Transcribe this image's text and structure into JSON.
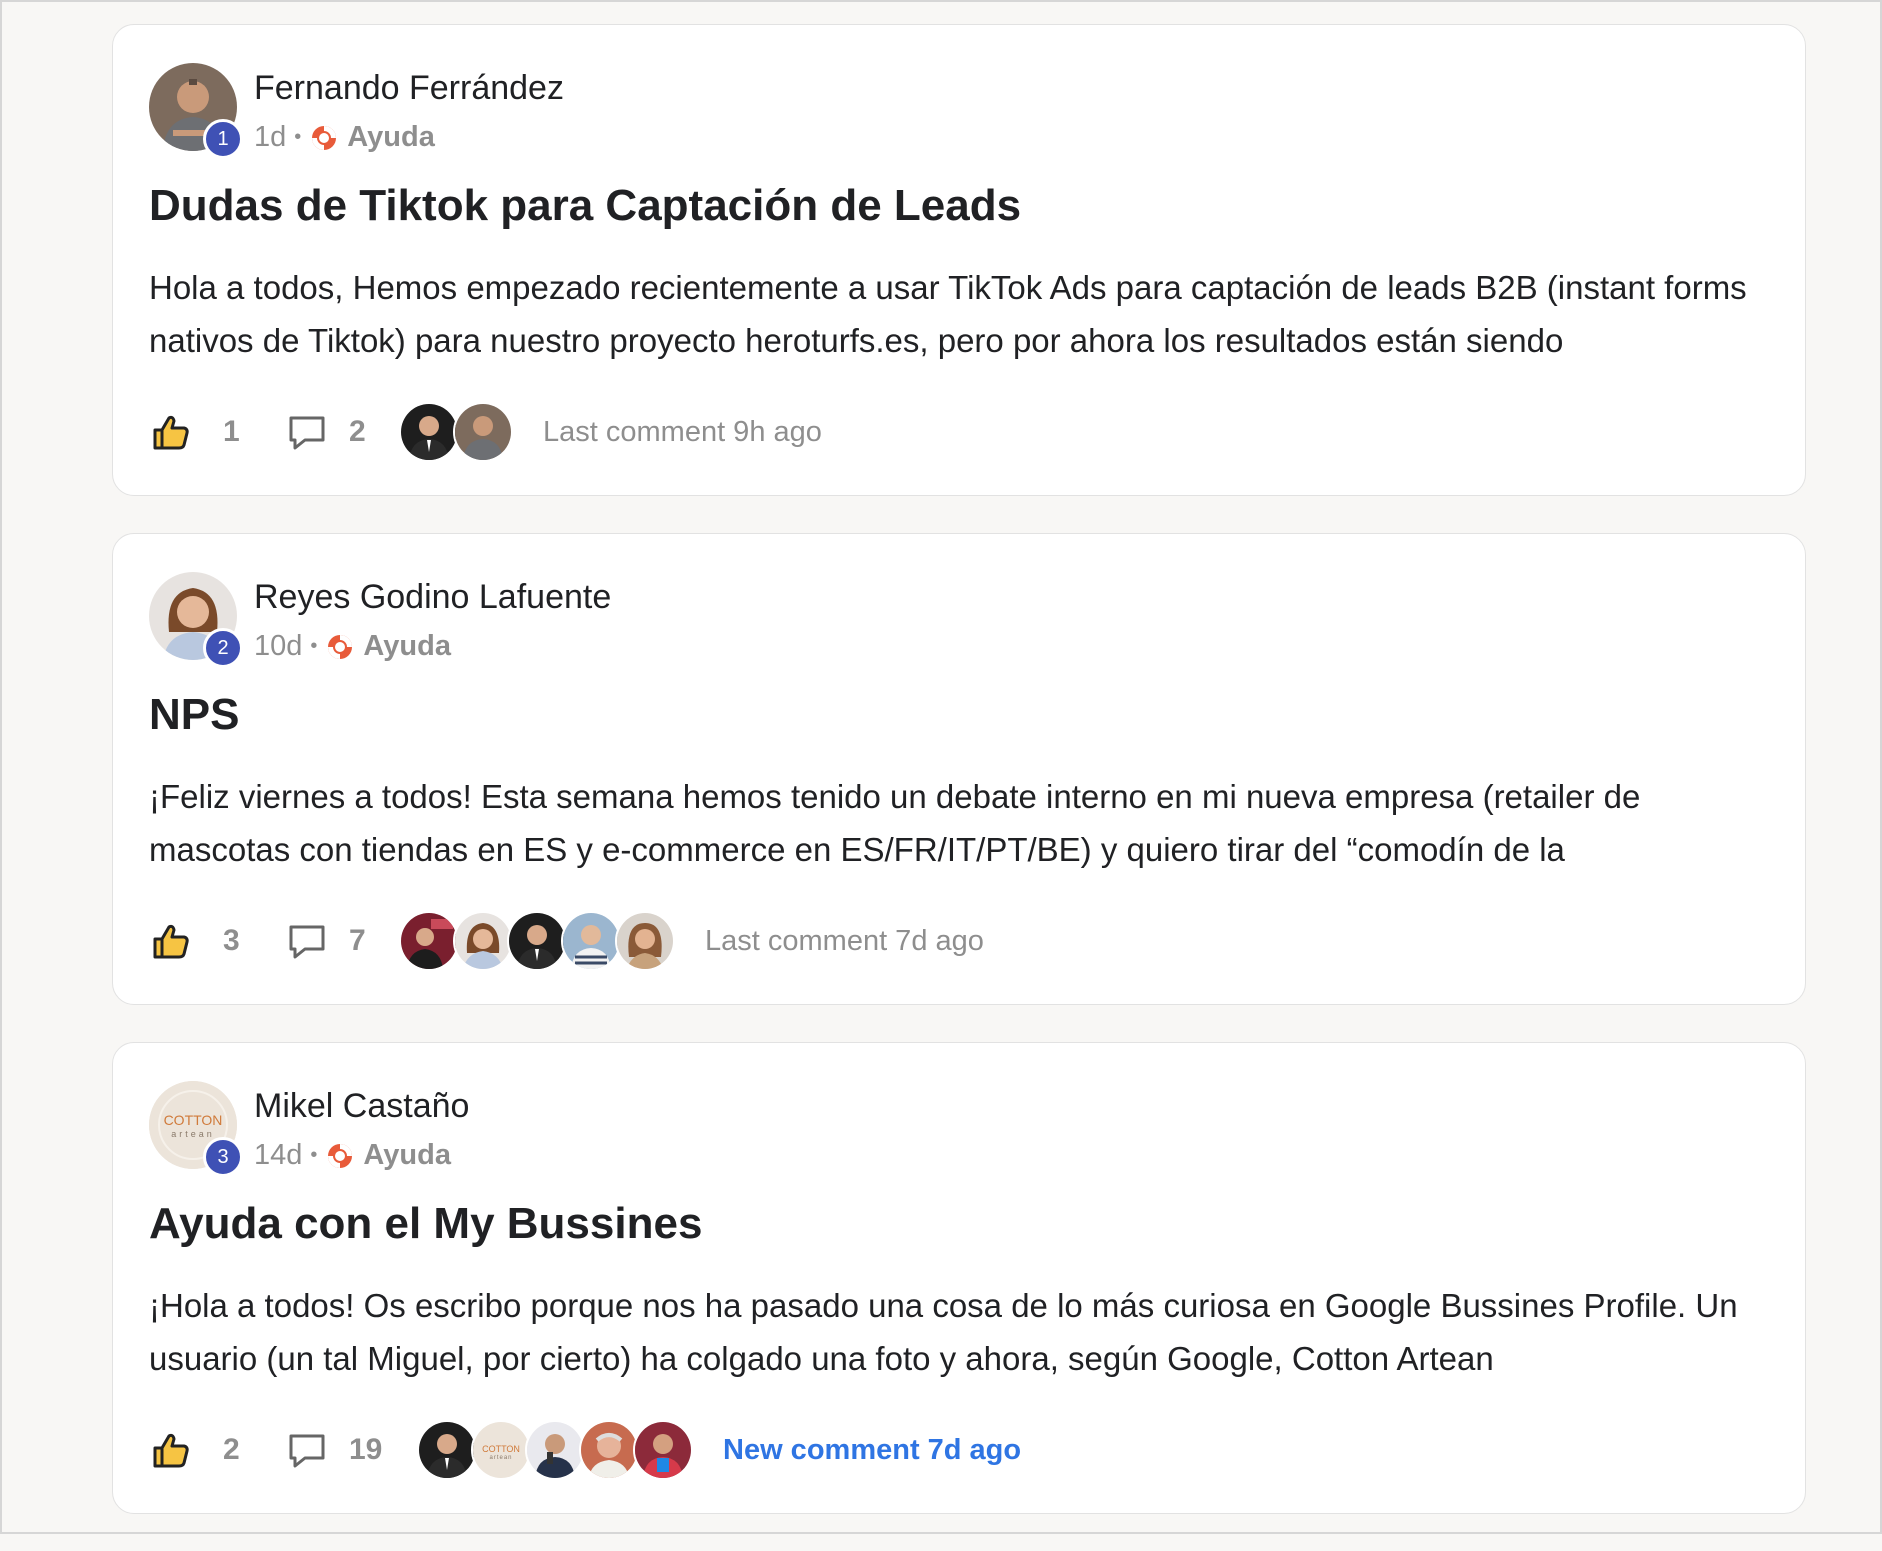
{
  "posts": [
    {
      "author": "Fernando Ferrández",
      "rank": "1",
      "time": "1d",
      "category": "Ayuda",
      "title": "Dudas de Tiktok para Captación de Leads",
      "body": "Hola a todos, Hemos empezado recientemente a usar TikTok Ads para captación de leads B2B (instant forms nativos de Tiktok) para nuestro proyecto heroturfs.es, pero por ahora los resultados están siendo",
      "likes": "1",
      "comments": "2",
      "last_comment": "Last comment 9h ago",
      "commenter_avatars": [
        "dark-suit",
        "brown-man"
      ]
    },
    {
      "author": "Reyes Godino Lafuente",
      "rank": "2",
      "time": "10d",
      "category": "Ayuda",
      "title": "NPS",
      "body": "¡Feliz viernes a todos! Esta semana hemos tenido un debate interno en mi nueva empresa (retailer de mascotas con tiendas en ES y e-commerce en ES/FR/IT/PT/BE) y quiero tirar del “comodín de la",
      "likes": "3",
      "comments": "7",
      "last_comment": "Last comment 7d ago",
      "commenter_avatars": [
        "red-stage",
        "woman-smile",
        "dark-suit",
        "striped-man",
        "woman-curly"
      ]
    },
    {
      "author": "Mikel Castaño",
      "rank": "3",
      "time": "14d",
      "category": "Ayuda",
      "title": "Ayuda con el My Bussines",
      "body": "¡Hola a todos! Os escribo porque nos ha pasado una cosa de lo más curiosa en Google Bussines Profile. Un usuario (un tal Miguel, por cierto) ha colgado una foto y ahora, según Google, Cotton Artean",
      "likes": "2",
      "comments": "19",
      "last_comment": "New comment 7d ago",
      "commenter_avatars": [
        "dark-suit",
        "cotton-logo",
        "man-mic",
        "older-man",
        "man-red"
      ]
    }
  ],
  "logo_text": {
    "brand": "COTTON",
    "sub": "artean"
  },
  "colors": {
    "rank_badge": "#3f51b5",
    "new_comment": "#2f75e3",
    "muted": "#8e8e8e"
  }
}
